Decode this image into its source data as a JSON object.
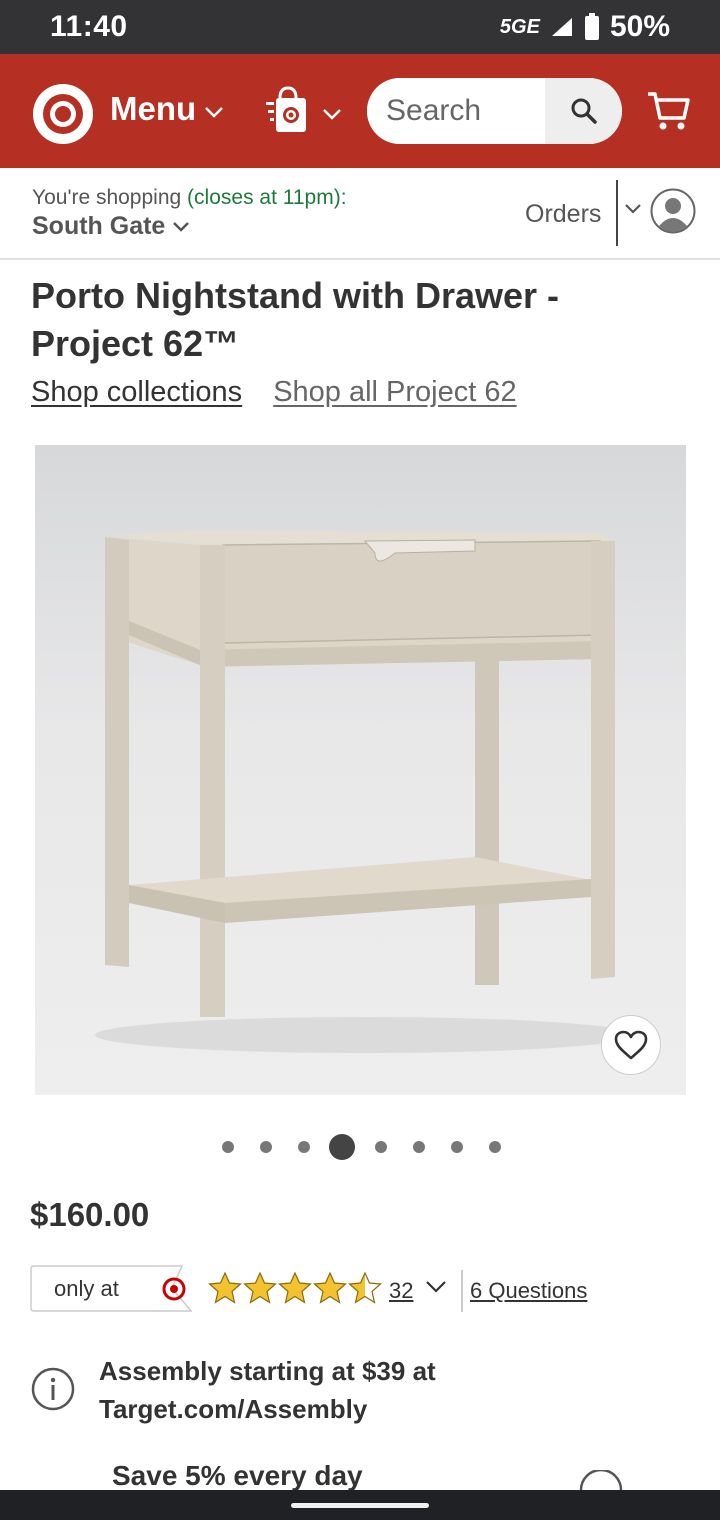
{
  "status_bar": {
    "time": "11:40",
    "network": "5GE",
    "battery": "50%"
  },
  "header": {
    "menu_label": "Menu",
    "search_placeholder": "Search",
    "brand_color": "#b53022"
  },
  "store_bar": {
    "shopping_prefix": "You're shopping",
    "closes_text": "(closes at 11pm):",
    "store_name": "South Gate",
    "orders_label": "Orders"
  },
  "product": {
    "title": "Porto Nightstand with Drawer - Project 62™",
    "links": {
      "collections": "Shop collections",
      "all_brand": "Shop all Project 62"
    },
    "image_count": 8,
    "active_image": 4,
    "price": "$160.00",
    "only_at_label": "only at",
    "rating_stars": 4.5,
    "rating_count": "32",
    "questions_label": "6 Questions",
    "assembly_text": "Assembly starting at $39 at Target.com/Assembly",
    "save_text": "Save 5% every day"
  },
  "icons": {
    "logo": "target-bullseye-icon",
    "bag": "store-pickup-bag-icon",
    "search": "search-icon",
    "cart": "cart-icon",
    "account": "account-avatar-icon",
    "favorite": "heart-icon",
    "info": "info-icon"
  }
}
